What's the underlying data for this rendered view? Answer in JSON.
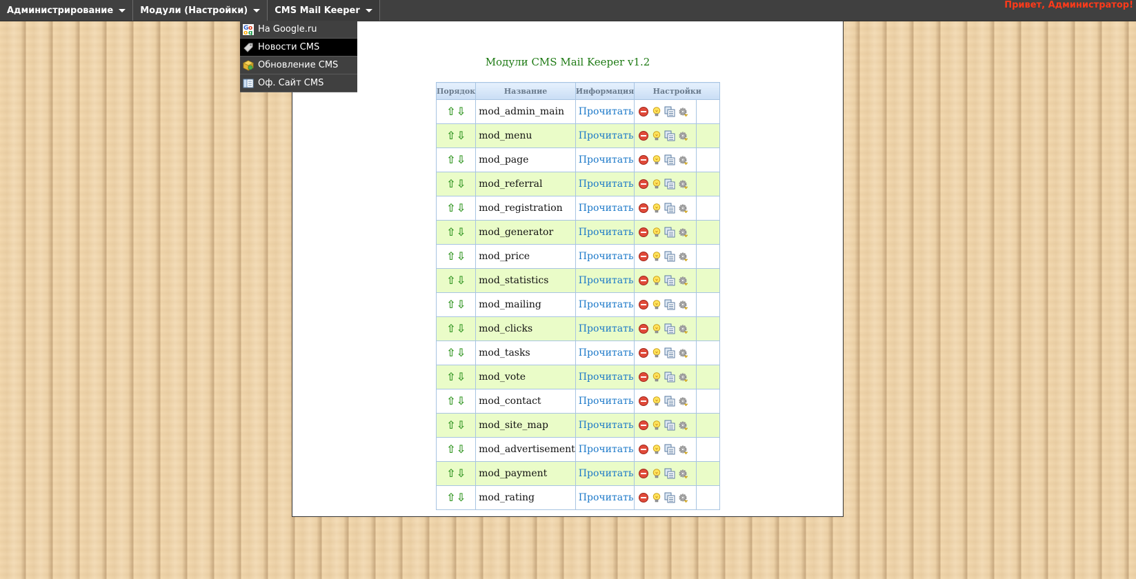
{
  "topbar": {
    "menus": [
      {
        "label": "Администрирование"
      },
      {
        "label": "Модули (Настройки)"
      },
      {
        "label": "CMS Mail Keeper"
      }
    ],
    "greeting": "Привет, Администратор!"
  },
  "dropdown": {
    "items": [
      {
        "label": "На Google.ru",
        "icon": "google-icon"
      },
      {
        "label": "Новости CMS",
        "icon": "tag-icon"
      },
      {
        "label": "Обновление CMS",
        "icon": "update-box-icon"
      },
      {
        "label": "Оф. Сайт CMS",
        "icon": "site-icon"
      }
    ],
    "active_index": 1
  },
  "colors": {
    "topbar": "#404040",
    "greeting": "#ff3a1a",
    "title": "#1e7a14",
    "link": "#1b78c8",
    "row_alt": "#eafcc8",
    "border": "#a7c4e2"
  },
  "main": {
    "title": "Модули CMS Mail Keeper v1.2",
    "table": {
      "headers": [
        "Порядок",
        "Название",
        "Информация",
        "Настройки"
      ],
      "read_label": "Прочитать",
      "order_icons": [
        "arrow-up-icon",
        "arrow-down-icon"
      ],
      "action_icons": [
        "delete-icon",
        "lightbulb-icon",
        "copy-icon",
        "settings-gear-icon"
      ],
      "rows": [
        {
          "name": "mod_admin_main"
        },
        {
          "name": "mod_menu"
        },
        {
          "name": "mod_page"
        },
        {
          "name": "mod_referral"
        },
        {
          "name": "mod_registration"
        },
        {
          "name": "mod_generator"
        },
        {
          "name": "mod_price"
        },
        {
          "name": "mod_statistics"
        },
        {
          "name": "mod_mailing"
        },
        {
          "name": "mod_clicks"
        },
        {
          "name": "mod_tasks"
        },
        {
          "name": "mod_vote"
        },
        {
          "name": "mod_contact"
        },
        {
          "name": "mod_site_map"
        },
        {
          "name": "mod_advertisement"
        },
        {
          "name": "mod_payment"
        },
        {
          "name": "mod_rating"
        }
      ]
    }
  }
}
